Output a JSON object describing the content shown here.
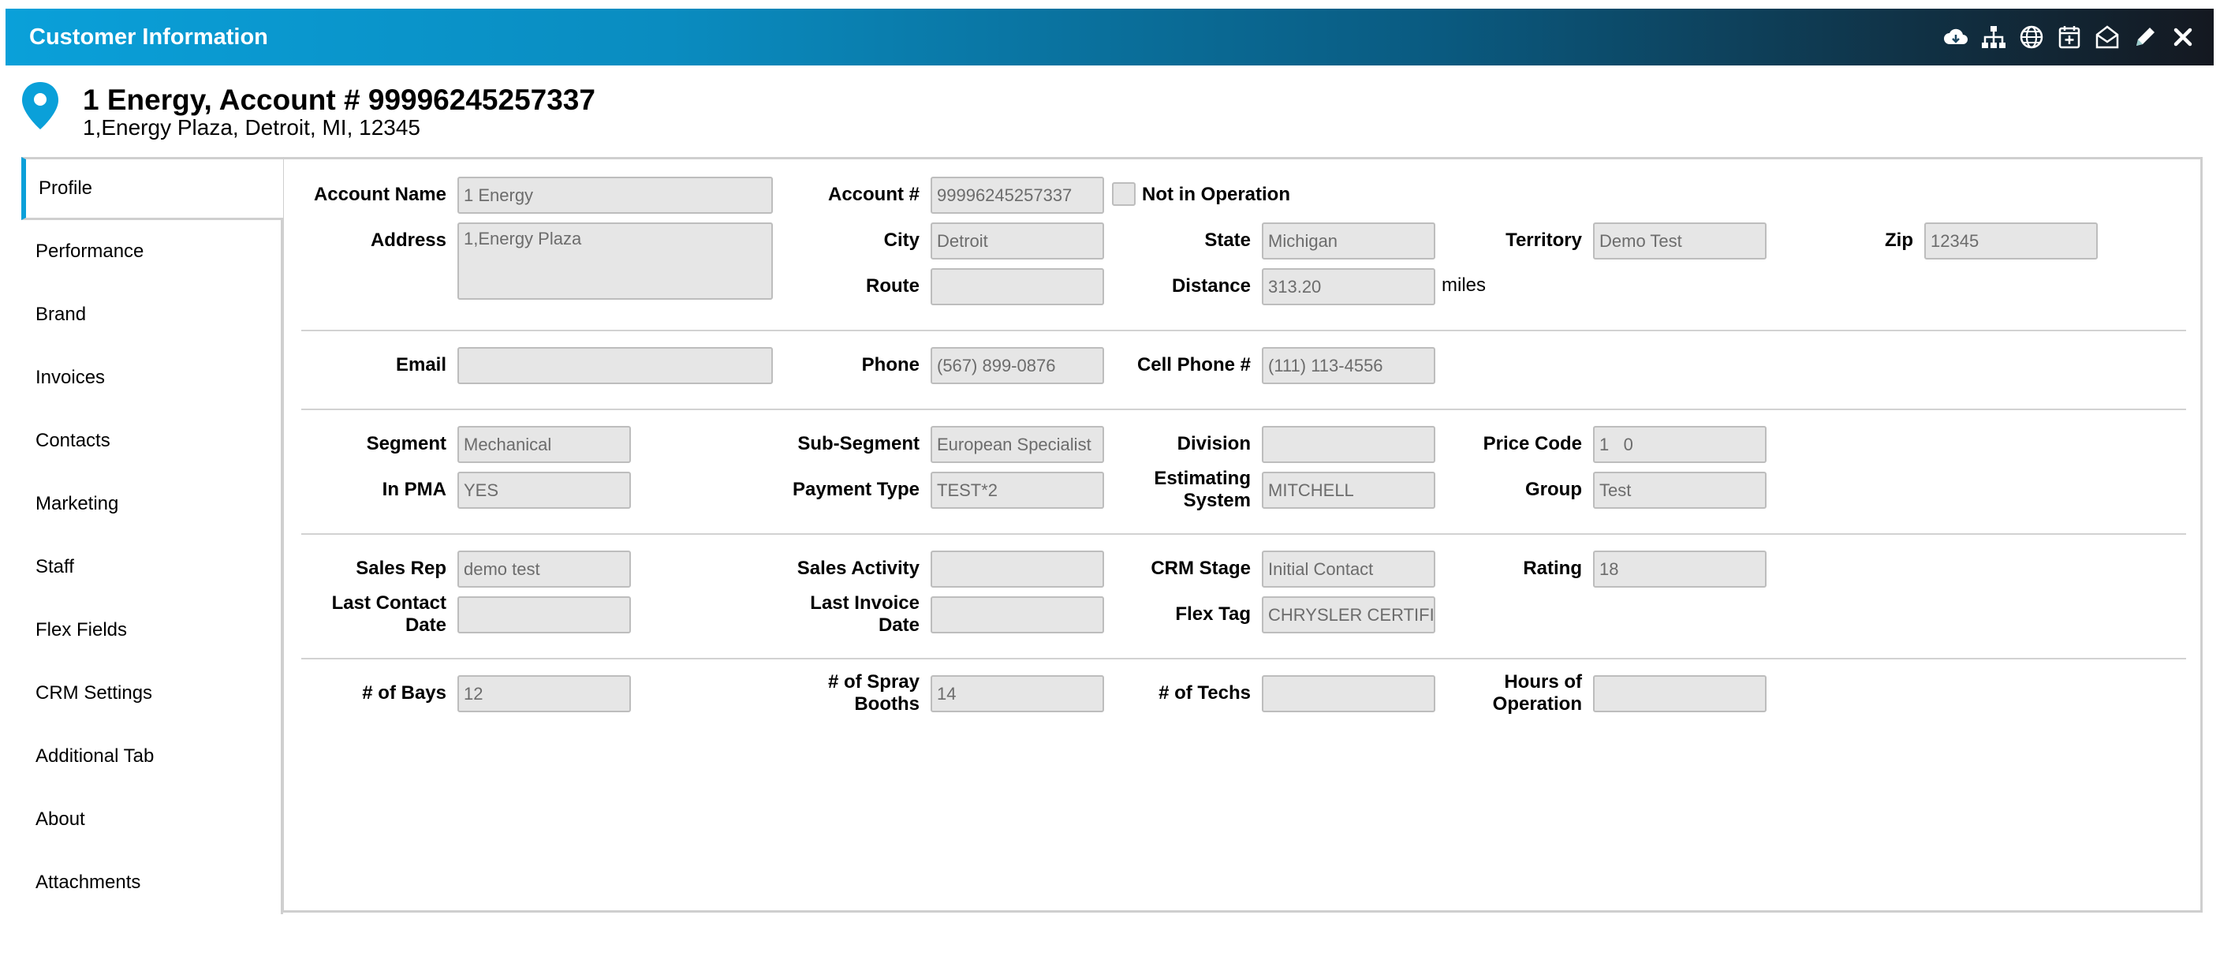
{
  "window": {
    "title": "Customer Information",
    "icons": [
      "download-cloud-icon",
      "org-chart-icon",
      "globe-icon",
      "calendar-add-icon",
      "envelope-open-icon",
      "pencil-icon",
      "close-icon"
    ]
  },
  "customer": {
    "title": "1 Energy, Account # 99996245257337",
    "address": "1,Energy Plaza, Detroit, MI, 12345"
  },
  "sidebar": {
    "items": [
      {
        "label": "Profile"
      },
      {
        "label": "Performance"
      },
      {
        "label": "Brand"
      },
      {
        "label": "Invoices"
      },
      {
        "label": "Contacts"
      },
      {
        "label": "Marketing"
      },
      {
        "label": "Staff"
      },
      {
        "label": "Flex Fields"
      },
      {
        "label": "CRM Settings"
      },
      {
        "label": "Additional Tab"
      },
      {
        "label": "About"
      },
      {
        "label": "Attachments"
      }
    ]
  },
  "profile": {
    "account_name": {
      "label": "Account Name",
      "value": "1 Energy"
    },
    "account_no": {
      "label": "Account #",
      "value": "99996245257337"
    },
    "not_in_operation": {
      "label": "Not in Operation"
    },
    "address": {
      "label": "Address",
      "value": "1,Energy Plaza"
    },
    "city": {
      "label": "City",
      "value": "Detroit"
    },
    "state": {
      "label": "State",
      "value": "Michigan"
    },
    "territory": {
      "label": "Territory",
      "value": "Demo Test"
    },
    "zip": {
      "label": "Zip",
      "value": "12345"
    },
    "route": {
      "label": "Route",
      "value": ""
    },
    "distance": {
      "label": "Distance",
      "value": "313.20",
      "unit": "miles"
    },
    "email": {
      "label": "Email",
      "value": ""
    },
    "phone": {
      "label": "Phone",
      "value": "(567) 899-0876"
    },
    "cell_phone": {
      "label": "Cell Phone #",
      "value": "(111) 113-4556"
    },
    "segment": {
      "label": "Segment",
      "value": "Mechanical"
    },
    "sub_segment": {
      "label": "Sub-Segment",
      "value": "European Specialist"
    },
    "division": {
      "label": "Division",
      "value": ""
    },
    "price_code": {
      "label": "Price Code",
      "value": "1   0"
    },
    "in_pma": {
      "label": "In PMA",
      "value": "YES"
    },
    "payment_type": {
      "label": "Payment Type",
      "value": "TEST*2"
    },
    "estimating_system": {
      "label_line1": "Estimating",
      "label_line2": "System",
      "value": "MITCHELL"
    },
    "group": {
      "label": "Group",
      "value": "Test"
    },
    "sales_rep": {
      "label": "Sales Rep",
      "value": "demo test"
    },
    "sales_activity": {
      "label": "Sales Activity",
      "value": ""
    },
    "crm_stage": {
      "label": "CRM Stage",
      "value": "Initial Contact"
    },
    "rating": {
      "label": "Rating",
      "value": "18"
    },
    "last_contact_date": {
      "label_line1": "Last Contact",
      "label_line2": "Date",
      "value": ""
    },
    "last_invoice_date": {
      "label_line1": "Last Invoice",
      "label_line2": "Date",
      "value": ""
    },
    "flex_tag": {
      "label": "Flex Tag",
      "value": "CHRYSLER CERTIFI"
    },
    "bays": {
      "label": "# of Bays",
      "value": "12"
    },
    "spray_booths": {
      "label_line1": "# of Spray",
      "label_line2": "Booths",
      "value": "14"
    },
    "techs": {
      "label": "# of Techs",
      "value": ""
    },
    "hours_of_operation": {
      "label_line1": "Hours of",
      "label_line2": "Operation",
      "value": ""
    }
  },
  "colors": {
    "accent": "#0aa0d9",
    "field_bg": "#e6e6e6",
    "field_text": "#6c6c6c"
  }
}
